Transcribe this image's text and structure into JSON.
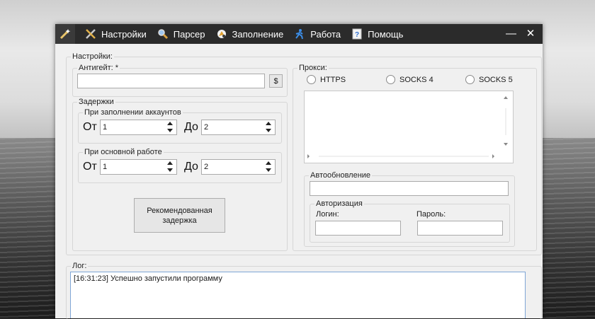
{
  "menu": {
    "items": [
      {
        "label": "Настройки",
        "icon": "tools-icon"
      },
      {
        "label": "Парсер",
        "icon": "magnifier-icon"
      },
      {
        "label": "Заполнение",
        "icon": "fill-icon"
      },
      {
        "label": "Работа",
        "icon": "running-person-icon"
      },
      {
        "label": "Помощь",
        "icon": "help-icon"
      }
    ],
    "minimize": "—",
    "close": "✕"
  },
  "settings": {
    "title": "Настройки:",
    "anticaptcha": {
      "title": "Антигейт: *",
      "value": "",
      "button": "$"
    },
    "delays": {
      "title": "Задержки",
      "fill_accounts": {
        "title": "При заполнении аккаунтов",
        "from_label": "От",
        "from": "1",
        "to_label": "До",
        "to": "2"
      },
      "main_work": {
        "title": "При основной работе",
        "from_label": "От",
        "from": "1",
        "to_label": "До",
        "to": "2"
      },
      "recommended_button": "Рекомендованная задержка"
    }
  },
  "proxy": {
    "title": "Прокси:",
    "types": [
      "HTTPS",
      "SOCKS 4",
      "SOCKS 5"
    ],
    "list_value": "",
    "autoupdate": {
      "title": "Автообновление",
      "url": "",
      "auth": {
        "title": "Авторизация",
        "login_label": "Логин:",
        "login": "",
        "password_label": "Пароль:",
        "password": ""
      }
    }
  },
  "log": {
    "title": "Лог:",
    "lines": [
      "[16:31:23] Успешно запустили программу"
    ]
  }
}
